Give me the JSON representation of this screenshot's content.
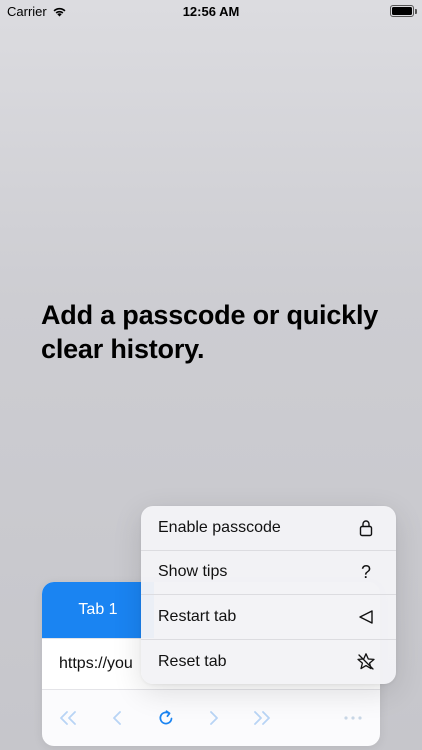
{
  "status": {
    "carrier": "Carrier",
    "time": "12:56 AM"
  },
  "headline": "Add a passcode or quickly clear history.",
  "browser": {
    "tab_label": "Tab 1",
    "url_text": "https://you"
  },
  "toolbar": {
    "icons": [
      "double-chevron-left-icon",
      "chevron-left-icon",
      "reload-icon",
      "chevron-right-icon",
      "double-chevron-right-icon",
      "more-icon"
    ]
  },
  "menu": {
    "items": [
      {
        "label": "Enable passcode",
        "icon": "lock-icon"
      },
      {
        "label": "Show tips",
        "icon": "question-icon",
        "glyph": "?"
      },
      {
        "label": "Restart tab",
        "icon": "triangle-left-icon"
      },
      {
        "label": "Reset tab",
        "icon": "star-slash-icon"
      }
    ]
  },
  "colors": {
    "accent": "#1a84f2",
    "toolbar_icon": "#b8d4f5",
    "reload_icon": "#1a84f2"
  }
}
